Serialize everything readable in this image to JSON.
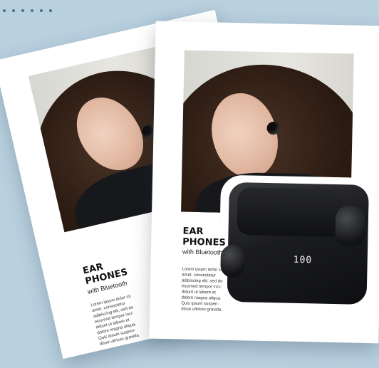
{
  "flyers": [
    {
      "title_line1": "EAR",
      "title_line2": "PHONES",
      "subtitle": "with Bluetooth",
      "body": "Lorem ipsum dolor sit\namet, consectetur\nadipiscing elit, sed do\neiusmod tempor inci-\ndidunt ut labore et\ndolore magna aliqua.\nQuis ipsum suspen-\ndisse ultrices gravida.",
      "display_text": "100"
    },
    {
      "title_line1": "EAR",
      "title_line2": "PHONES",
      "subtitle": "with Bluetooth",
      "body": "Lorem ipsum dolor sit\namet, consectetur\nadipiscing elit, sed do\neiusmod tempor inci-\ndidunt ut labore et\ndolore magna aliqua.\nQuis ipsum suspen-\ndisse ultrices gravida.",
      "display_text": "100"
    }
  ],
  "colors": {
    "background": "#b9d0df",
    "dots": "#4f6f86",
    "paper": "#ffffff",
    "title": "#111111"
  },
  "decorations": {
    "dot_count": 6
  }
}
